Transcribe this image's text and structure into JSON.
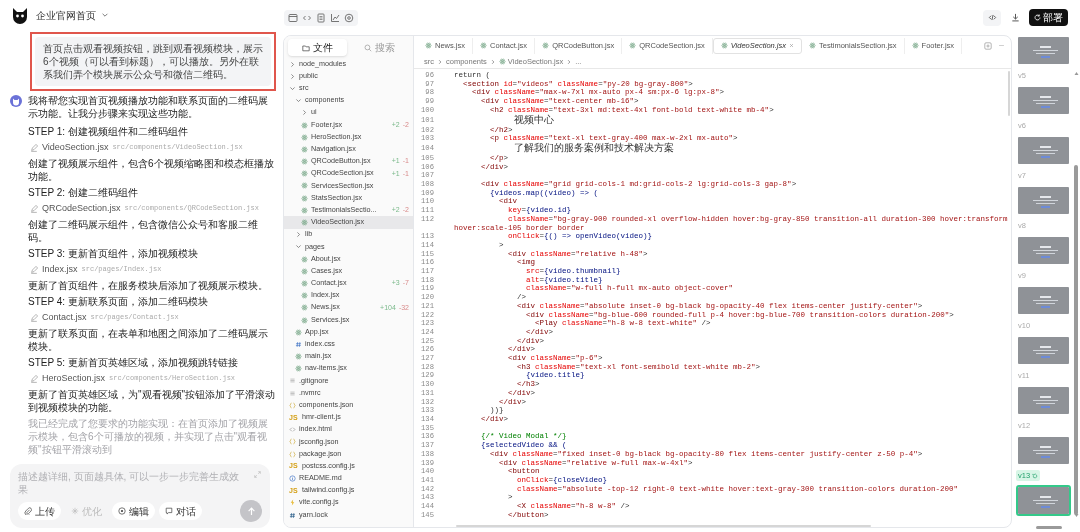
{
  "project": {
    "title": "企业官网首页"
  },
  "chat": {
    "user_message": "首页点击观看视频按钮，跳到观看视频模块，展示6个视频（可以看到标题），可以播放。另外在联系我们弄个模块展示公众号和微信二维码。",
    "assistant": {
      "intro": "我将帮您实现首页视频播放功能和联系页面的二维码展示功能。让我分步骤来实现这些功能。",
      "steps": [
        {
          "title": "STEP 1: 创建视频组件和二维码组件",
          "file": {
            "name": "VideoSection.jsx",
            "path": "src/components/VideoSection.jsx"
          },
          "note": "创建了视频展示组件，包含6个视频缩略图和模态框播放功能。"
        },
        {
          "title": "STEP 2: 创建二维码组件",
          "file": {
            "name": "QRCodeSection.jsx",
            "path": "src/components/QRCodeSection.jsx"
          },
          "note": "创建了二维码展示组件，包含微信公众号和客服二维码。"
        },
        {
          "title": "STEP 3: 更新首页组件，添加视频模块",
          "file": {
            "name": "Index.jsx",
            "path": "src/pages/Index.jsx"
          },
          "note": "更新了首页组件，在服务模块后添加了视频展示模块。"
        },
        {
          "title": "STEP 4: 更新联系页面，添加二维码模块",
          "file": {
            "name": "Contact.jsx",
            "path": "src/pages/Contact.jsx"
          },
          "note": "更新了联系页面，在表单和地图之间添加了二维码展示模块。"
        },
        {
          "title": "STEP 5: 更新首页英雄区域，添加视频跳转链接",
          "file": {
            "name": "HeroSection.jsx",
            "path": "src/components/HeroSection.jsx"
          },
          "note": "更新了首页英雄区域，为\"观看视频\"按钮添加了平滑滚动到视频模块的功能。"
        }
      ],
      "summary": "我已经完成了您要求的功能实现：在首页添加了视频展示模块，包含6个可播放的视频，并实现了点击\"观看视频\"按钮平滑滚动到"
    }
  },
  "input": {
    "placeholder": "描述越详细, 页面越具体, 可以一步一步完善生成效果",
    "send_disabled": true,
    "tools": [
      {
        "kind": "upload",
        "label": "上传",
        "disabled": false
      },
      {
        "kind": "optimize",
        "label": "优化",
        "disabled": true
      },
      {
        "kind": "edit",
        "label": "编辑",
        "disabled": false
      },
      {
        "kind": "chat",
        "label": "对话",
        "disabled": false
      }
    ]
  },
  "toolbar": {
    "deploy_label": "部署"
  },
  "file_panel": {
    "tabs": [
      {
        "kind": "files",
        "label": "文件",
        "selected": true
      },
      {
        "kind": "search",
        "label": "搜索",
        "selected": false
      }
    ],
    "tree": [
      {
        "name": "node_modules",
        "kind": "folder",
        "expanded": false
      },
      {
        "name": "public",
        "kind": "folder",
        "expanded": false
      },
      {
        "name": "src",
        "kind": "folder",
        "expanded": true,
        "children": [
          {
            "name": "components",
            "kind": "folder",
            "expanded": true,
            "children": [
              {
                "name": "ui",
                "kind": "folder",
                "expanded": false
              },
              {
                "name": "Footer.jsx",
                "kind": "react",
                "added": "+2",
                "removed": "-2",
                "selected": false
              },
              {
                "name": "HeroSection.jsx",
                "kind": "react",
                "selected": false
              },
              {
                "name": "Navigation.jsx",
                "kind": "react",
                "selected": false
              },
              {
                "name": "QRCodeButton.jsx",
                "kind": "react",
                "added": "+1",
                "removed": "-1",
                "selected": false
              },
              {
                "name": "QRCodeSection.jsx",
                "kind": "react",
                "added": "+1",
                "removed": "-1",
                "selected": false
              },
              {
                "name": "ServicesSection.jsx",
                "kind": "react",
                "selected": false
              },
              {
                "name": "StatsSection.jsx",
                "kind": "react",
                "selected": false
              },
              {
                "name": "TestimonialsSectio...",
                "kind": "react",
                "added": "+2",
                "removed": "-2",
                "selected": false
              },
              {
                "name": "VideoSection.jsx",
                "kind": "react",
                "selected": true
              }
            ]
          },
          {
            "name": "lib",
            "kind": "folder",
            "expanded": false
          },
          {
            "name": "pages",
            "kind": "folder",
            "expanded": true,
            "children": [
              {
                "name": "About.jsx",
                "kind": "react",
                "selected": false
              },
              {
                "name": "Cases.jsx",
                "kind": "react",
                "selected": false
              },
              {
                "name": "Contact.jsx",
                "kind": "react",
                "added": "+3",
                "removed": "-7",
                "selected": false
              },
              {
                "name": "Index.jsx",
                "kind": "react",
                "selected": false
              },
              {
                "name": "News.jsx",
                "kind": "react",
                "added": "+104",
                "removed": "-32",
                "selected": false
              },
              {
                "name": "Services.jsx",
                "kind": "react",
                "selected": false
              }
            ]
          },
          {
            "name": "App.jsx",
            "kind": "react",
            "selected": false
          },
          {
            "name": "index.css",
            "kind": "css",
            "selected": false
          },
          {
            "name": "main.jsx",
            "kind": "react",
            "selected": false
          },
          {
            "name": "nav-items.jsx",
            "kind": "react",
            "selected": false
          }
        ]
      },
      {
        "name": ".gitignore",
        "kind": "text",
        "selected": false
      },
      {
        "name": ".nvmrc",
        "kind": "text",
        "selected": false
      },
      {
        "name": "components.json",
        "kind": "json",
        "selected": false
      },
      {
        "name": "hmr-client.js",
        "kind": "js",
        "icon_text": "JS",
        "selected": false
      },
      {
        "name": "index.html",
        "kind": "html",
        "selected": false
      },
      {
        "name": "jsconfig.json",
        "kind": "json",
        "selected": false
      },
      {
        "name": "package.json",
        "kind": "json",
        "selected": false
      },
      {
        "name": "postcss.config.js",
        "kind": "js",
        "icon_text": "JS",
        "selected": false
      },
      {
        "name": "README.md",
        "kind": "info",
        "selected": false
      },
      {
        "name": "tailwind.config.js",
        "kind": "js",
        "icon_text": "JS",
        "selected": false
      },
      {
        "name": "vite.config.js",
        "kind": "vite",
        "selected": false
      },
      {
        "name": "yarn.lock",
        "kind": "lock",
        "selected": false
      }
    ]
  },
  "editor": {
    "tabs": [
      {
        "label": "News.jsx",
        "selected": false
      },
      {
        "label": "Contact.jsx",
        "selected": false
      },
      {
        "label": "QRCodeButton.jsx",
        "selected": false
      },
      {
        "label": "QRCodeSection.jsx",
        "selected": false
      },
      {
        "label": "VideoSection.jsx",
        "selected": true
      },
      {
        "label": "TestimonialsSection.jsx",
        "selected": false
      },
      {
        "label": "Footer.jsx",
        "selected": false
      }
    ],
    "breadcrumb": [
      {
        "label": "src",
        "kind": "folder"
      },
      {
        "label": "components",
        "kind": "folder"
      },
      {
        "label": "VideoSection.jsx",
        "kind": "react"
      },
      {
        "label": "...",
        "kind": "more"
      }
    ],
    "lines": [
      {
        "number": "96",
        "code": "return ("
      },
      {
        "number": "97",
        "code": "  <section id=\"videos\" className=\"py-20 bg-gray-800\">"
      },
      {
        "number": "98",
        "code": "    <div className=\"max-w-7xl mx-auto px-4 sm:px-6 lg:px-8\">"
      },
      {
        "number": "99",
        "code": "      <div className=\"text-center mb-16\">"
      },
      {
        "number": "100",
        "code": "        <h2 className=\"text-3xl md:text-4xl font-bold text-white mb-4\">"
      },
      {
        "number": "101",
        "code": "          视频中心"
      },
      {
        "number": "102",
        "code": "        </h2>"
      },
      {
        "number": "103",
        "code": "        <p className=\"text-xl text-gray-400 max-w-2xl mx-auto\">"
      },
      {
        "number": "104",
        "code": "          了解我们的服务案例和技术解决方案"
      },
      {
        "number": "105",
        "code": "        </p>"
      },
      {
        "number": "106",
        "code": "      </div>"
      },
      {
        "number": "107"
      },
      {
        "number": "108",
        "code": "      <div className=\"grid grid-cols-1 md:grid-cols-2 lg:grid-cols-3 gap-8\">"
      },
      {
        "number": "109",
        "code": "        {videos.map((video) => ("
      },
      {
        "number": "110",
        "code": "          <div"
      },
      {
        "number": "111",
        "code": "            key={video.id}"
      },
      {
        "number": "112",
        "code": "            className=\"bg-gray-900 rounded-xl overflow-hidden hover:bg-gray-850 transition-all duration-300 hover:transform hover:scale-105 border border"
      },
      {
        "number": "113",
        "code": "            onClick={() => openVideo(video)}"
      },
      {
        "number": "114",
        "code": "          >"
      },
      {
        "number": "115",
        "code": "            <div className=\"relative h-48\">"
      },
      {
        "number": "116",
        "code": "              <img"
      },
      {
        "number": "117",
        "code": "                src={video.thumbnail}"
      },
      {
        "number": "118",
        "code": "                alt={video.title}"
      },
      {
        "number": "119",
        "code": "                className=\"w-full h-full mx-auto object-cover\""
      },
      {
        "number": "120",
        "code": "              />"
      },
      {
        "number": "121",
        "code": "              <div className=\"absolute inset-0 bg-black bg-opacity-40 flex items-center justify-center\">"
      },
      {
        "number": "122",
        "code": "                <div className=\"bg-blue-600 rounded-full p-4 hover:bg-blue-700 transition-colors duration-200\">"
      },
      {
        "number": "123",
        "code": "                  <Play className=\"h-8 w-8 text-white\" />"
      },
      {
        "number": "124",
        "code": "                </div>"
      },
      {
        "number": "125",
        "code": "              </div>"
      },
      {
        "number": "126",
        "code": "            </div>"
      },
      {
        "number": "127",
        "code": "            <div className=\"p-6\">"
      },
      {
        "number": "128",
        "code": "              <h3 className=\"text-xl font-semibold text-white mb-2\">"
      },
      {
        "number": "129",
        "code": "                {video.title}"
      },
      {
        "number": "130",
        "code": "              </h3>"
      },
      {
        "number": "131",
        "code": "            </div>"
      },
      {
        "number": "132",
        "code": "          </div>"
      },
      {
        "number": "133",
        "code": "        ))}"
      },
      {
        "number": "134",
        "code": "      </div>"
      },
      {
        "number": "135"
      },
      {
        "number": "136",
        "code": "      {/* Video Modal */}"
      },
      {
        "number": "137",
        "code": "      {selectedVideo && ("
      },
      {
        "number": "138",
        "code": "        <div className=\"fixed inset-0 bg-black bg-opacity-80 flex items-center justify-center z-50 p-4\">"
      },
      {
        "number": "139",
        "code": "          <div className=\"relative w-full max-w-4xl\">"
      },
      {
        "number": "140",
        "code": "            <button"
      },
      {
        "number": "141",
        "code": "              onClick={closeVideo}"
      },
      {
        "number": "142",
        "code": "              className=\"absolute -top-12 right-0 text-white hover:text-gray-300 transition-colors duration-200\""
      },
      {
        "number": "143",
        "code": "            >"
      },
      {
        "number": "144",
        "code": "              <X className=\"h-8 w-8\" />"
      },
      {
        "number": "145",
        "code": "            </button>"
      }
    ]
  },
  "versions": [
    {
      "selected": false
    },
    {
      "label": "v5",
      "selected": false
    },
    {
      "label": "v6",
      "selected": false
    },
    {
      "label": "v7",
      "selected": false
    },
    {
      "label": "v8",
      "selected": false
    },
    {
      "label": "v9",
      "selected": false
    },
    {
      "label": "v10",
      "selected": false
    },
    {
      "label": "v11",
      "selected": false
    },
    {
      "label": "v12",
      "selected": false
    },
    {
      "label": "v13",
      "selected": true
    }
  ]
}
